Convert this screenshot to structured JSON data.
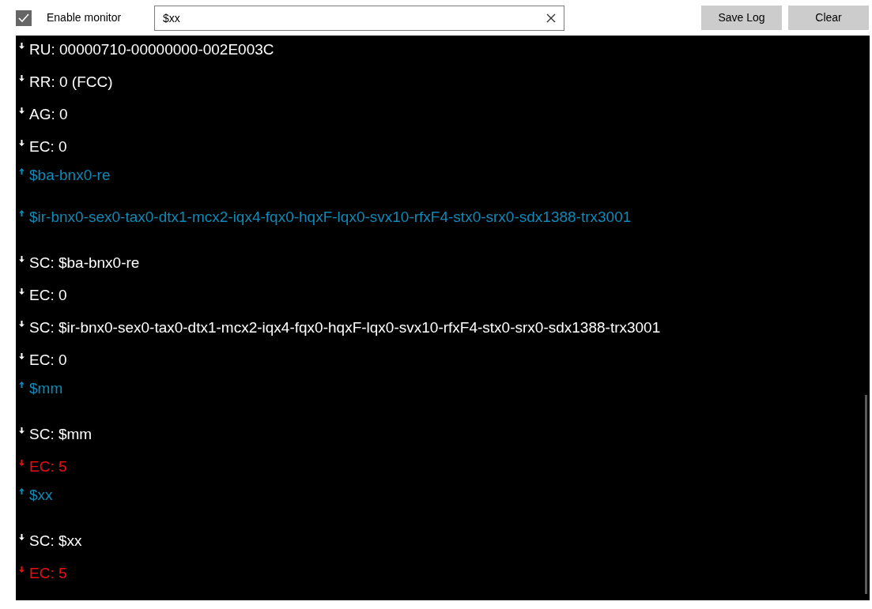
{
  "toolbar": {
    "monitor": {
      "label": "Enable monitor",
      "checked": true
    },
    "filter": {
      "value": "$xx"
    },
    "buttons": [
      "Save Log",
      "Clear"
    ]
  },
  "log": [
    {
      "kind": "received",
      "text": "RU: 00000710-00000000-002E003C"
    },
    {
      "kind": "received",
      "text": "RR: 0 (FCC)"
    },
    {
      "kind": "received",
      "text": "AG: 0"
    },
    {
      "kind": "received",
      "text": "EC: 0"
    },
    {
      "kind": "sent",
      "text": "$ba-bnx0-re"
    },
    {
      "kind": "sent",
      "text": "$ir-bnx0-sex0-tax0-dtx1-mcx2-iqx4-fqx0-hqxF-lqx0-svx10-rfxF4-stx0-srx0-sdx1388-trx3001"
    },
    {
      "kind": "received",
      "text": "SC: $ba-bnx0-re"
    },
    {
      "kind": "received",
      "text": "EC: 0"
    },
    {
      "kind": "received",
      "text": "SC: $ir-bnx0-sex0-tax0-dtx1-mcx2-iqx4-fqx0-hqxF-lqx0-svx10-rfxF4-stx0-srx0-sdx1388-trx3001"
    },
    {
      "kind": "received",
      "text": "EC: 0"
    },
    {
      "kind": "sent",
      "text": "$mm"
    },
    {
      "kind": "received",
      "text": "SC: $mm"
    },
    {
      "kind": "error",
      "text": "EC: 5"
    },
    {
      "kind": "sent",
      "text": "$xx"
    },
    {
      "kind": "received",
      "text": "SC: $xx"
    },
    {
      "kind": "error",
      "text": "EC: 5"
    }
  ]
}
